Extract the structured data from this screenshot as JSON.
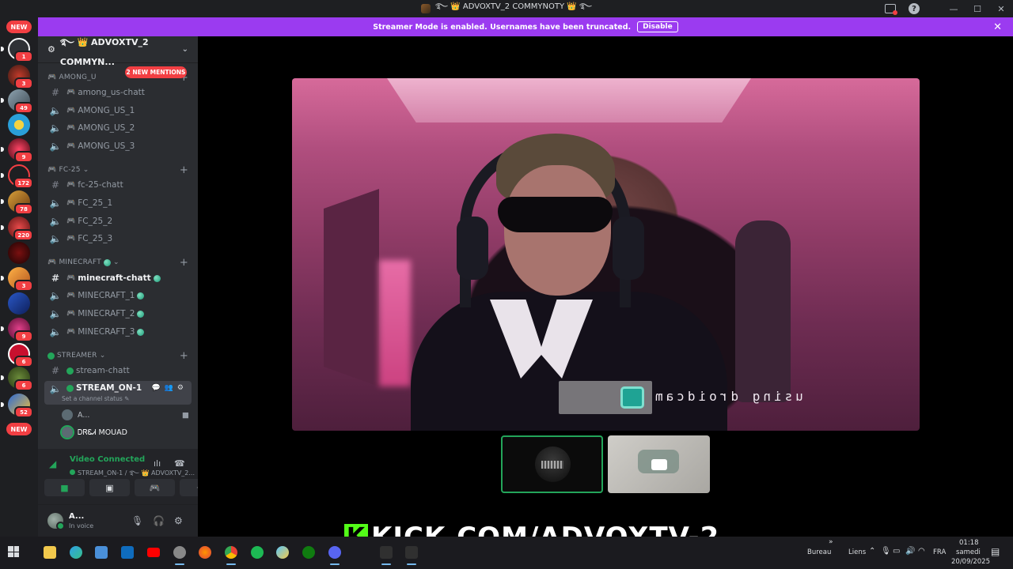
{
  "window": {
    "title": "࿐ 👑 ADVOXTV_2 COMMYNOTY 👑 ࿐",
    "min": "—",
    "max": "☐",
    "close": "✕",
    "help": "?"
  },
  "banner": {
    "message": "Streamer Mode is enabled. Usernames have been truncated.",
    "disable_label": "Disable",
    "close": "✕"
  },
  "rail": {
    "new_top": "NEW",
    "new_bottom": "NEW",
    "badges": [
      "1",
      "3",
      "49",
      "",
      "9",
      "172",
      "78",
      "220",
      "",
      "3",
      "",
      "9",
      "6",
      "6",
      "52"
    ]
  },
  "guild": {
    "name": "࿐ 👑 ADVOXTV_2 COMMYN...",
    "chevron": "⌄"
  },
  "mentions_pill": "2 NEW MENTIONS",
  "categories": [
    {
      "label": "🎮 AMONG_U",
      "arrow": ""
    },
    {
      "label": "🎮 FC-25",
      "arrow": "⌄"
    },
    {
      "label": "🎮 MINECRAFT",
      "arrow": "⌄"
    },
    {
      "label": "STREAMER",
      "arrow": "⌄"
    }
  ],
  "channels": {
    "among_chat": "among_us-chatt",
    "among_1": "AMONG_US_1",
    "among_2": "AMONG_US_2",
    "among_3": "AMONG_US_3",
    "fc_chat": "fc-25-chatt",
    "fc_1": "FC_25_1",
    "fc_2": "FC_25_2",
    "fc_3": "FC_25_3",
    "mc_chat": "minecraft-chatt",
    "mc_1": "MINECRAFT_1",
    "mc_2": "MINECRAFT_2",
    "mc_3": "MINECRAFT_3",
    "stream_chat": "stream-chatt",
    "stream_on": "STREAM_ON-1",
    "status_note": "Set a channel status ✎"
  },
  "voice_users": [
    {
      "name": "A..."
    },
    {
      "name": "ᎠᏒᏋᏗ MOUAD"
    }
  ],
  "rtc": {
    "status": "Video Connected",
    "location": "STREAM_ON-1 / ࿐ 👑 ADVOXTV_2..."
  },
  "user": {
    "name": "A...",
    "status": "In voice"
  },
  "video_overlay_text": "using droidcam",
  "kick": {
    "logo": "K",
    "text": "KICK.COM/ADVOXTV-2"
  },
  "taskbar": {
    "bureau": "Bureau",
    "liens": "Liens",
    "lang": "FRA",
    "time": "01:18",
    "day": "samedi",
    "date": "20/09/2025"
  },
  "colors": {
    "accent_green": "#23a55a",
    "banner_purple": "#9b3bf0",
    "mention_red": "#f23f43",
    "kick_green": "#53fc18"
  }
}
